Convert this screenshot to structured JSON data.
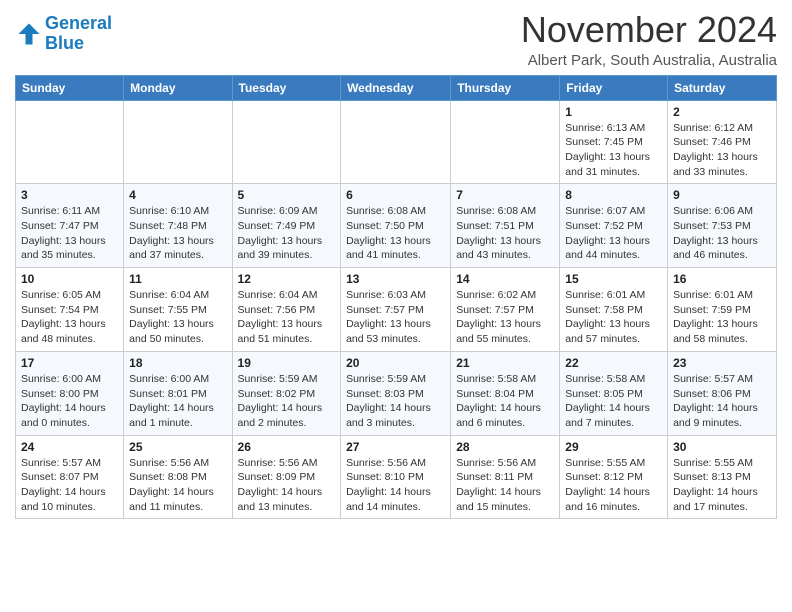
{
  "header": {
    "logo_line1": "General",
    "logo_line2": "Blue",
    "month_title": "November 2024",
    "subtitle": "Albert Park, South Australia, Australia"
  },
  "weekdays": [
    "Sunday",
    "Monday",
    "Tuesday",
    "Wednesday",
    "Thursday",
    "Friday",
    "Saturday"
  ],
  "weeks": [
    [
      {
        "day": "",
        "info": ""
      },
      {
        "day": "",
        "info": ""
      },
      {
        "day": "",
        "info": ""
      },
      {
        "day": "",
        "info": ""
      },
      {
        "day": "",
        "info": ""
      },
      {
        "day": "1",
        "info": "Sunrise: 6:13 AM\nSunset: 7:45 PM\nDaylight: 13 hours\nand 31 minutes."
      },
      {
        "day": "2",
        "info": "Sunrise: 6:12 AM\nSunset: 7:46 PM\nDaylight: 13 hours\nand 33 minutes."
      }
    ],
    [
      {
        "day": "3",
        "info": "Sunrise: 6:11 AM\nSunset: 7:47 PM\nDaylight: 13 hours\nand 35 minutes."
      },
      {
        "day": "4",
        "info": "Sunrise: 6:10 AM\nSunset: 7:48 PM\nDaylight: 13 hours\nand 37 minutes."
      },
      {
        "day": "5",
        "info": "Sunrise: 6:09 AM\nSunset: 7:49 PM\nDaylight: 13 hours\nand 39 minutes."
      },
      {
        "day": "6",
        "info": "Sunrise: 6:08 AM\nSunset: 7:50 PM\nDaylight: 13 hours\nand 41 minutes."
      },
      {
        "day": "7",
        "info": "Sunrise: 6:08 AM\nSunset: 7:51 PM\nDaylight: 13 hours\nand 43 minutes."
      },
      {
        "day": "8",
        "info": "Sunrise: 6:07 AM\nSunset: 7:52 PM\nDaylight: 13 hours\nand 44 minutes."
      },
      {
        "day": "9",
        "info": "Sunrise: 6:06 AM\nSunset: 7:53 PM\nDaylight: 13 hours\nand 46 minutes."
      }
    ],
    [
      {
        "day": "10",
        "info": "Sunrise: 6:05 AM\nSunset: 7:54 PM\nDaylight: 13 hours\nand 48 minutes."
      },
      {
        "day": "11",
        "info": "Sunrise: 6:04 AM\nSunset: 7:55 PM\nDaylight: 13 hours\nand 50 minutes."
      },
      {
        "day": "12",
        "info": "Sunrise: 6:04 AM\nSunset: 7:56 PM\nDaylight: 13 hours\nand 51 minutes."
      },
      {
        "day": "13",
        "info": "Sunrise: 6:03 AM\nSunset: 7:57 PM\nDaylight: 13 hours\nand 53 minutes."
      },
      {
        "day": "14",
        "info": "Sunrise: 6:02 AM\nSunset: 7:57 PM\nDaylight: 13 hours\nand 55 minutes."
      },
      {
        "day": "15",
        "info": "Sunrise: 6:01 AM\nSunset: 7:58 PM\nDaylight: 13 hours\nand 57 minutes."
      },
      {
        "day": "16",
        "info": "Sunrise: 6:01 AM\nSunset: 7:59 PM\nDaylight: 13 hours\nand 58 minutes."
      }
    ],
    [
      {
        "day": "17",
        "info": "Sunrise: 6:00 AM\nSunset: 8:00 PM\nDaylight: 14 hours\nand 0 minutes."
      },
      {
        "day": "18",
        "info": "Sunrise: 6:00 AM\nSunset: 8:01 PM\nDaylight: 14 hours\nand 1 minute."
      },
      {
        "day": "19",
        "info": "Sunrise: 5:59 AM\nSunset: 8:02 PM\nDaylight: 14 hours\nand 2 minutes."
      },
      {
        "day": "20",
        "info": "Sunrise: 5:59 AM\nSunset: 8:03 PM\nDaylight: 14 hours\nand 3 minutes."
      },
      {
        "day": "21",
        "info": "Sunrise: 5:58 AM\nSunset: 8:04 PM\nDaylight: 14 hours\nand 6 minutes."
      },
      {
        "day": "22",
        "info": "Sunrise: 5:58 AM\nSunset: 8:05 PM\nDaylight: 14 hours\nand 7 minutes."
      },
      {
        "day": "23",
        "info": "Sunrise: 5:57 AM\nSunset: 8:06 PM\nDaylight: 14 hours\nand 9 minutes."
      }
    ],
    [
      {
        "day": "24",
        "info": "Sunrise: 5:57 AM\nSunset: 8:07 PM\nDaylight: 14 hours\nand 10 minutes."
      },
      {
        "day": "25",
        "info": "Sunrise: 5:56 AM\nSunset: 8:08 PM\nDaylight: 14 hours\nand 11 minutes."
      },
      {
        "day": "26",
        "info": "Sunrise: 5:56 AM\nSunset: 8:09 PM\nDaylight: 14 hours\nand 13 minutes."
      },
      {
        "day": "27",
        "info": "Sunrise: 5:56 AM\nSunset: 8:10 PM\nDaylight: 14 hours\nand 14 minutes."
      },
      {
        "day": "28",
        "info": "Sunrise: 5:56 AM\nSunset: 8:11 PM\nDaylight: 14 hours\nand 15 minutes."
      },
      {
        "day": "29",
        "info": "Sunrise: 5:55 AM\nSunset: 8:12 PM\nDaylight: 14 hours\nand 16 minutes."
      },
      {
        "day": "30",
        "info": "Sunrise: 5:55 AM\nSunset: 8:13 PM\nDaylight: 14 hours\nand 17 minutes."
      }
    ]
  ]
}
